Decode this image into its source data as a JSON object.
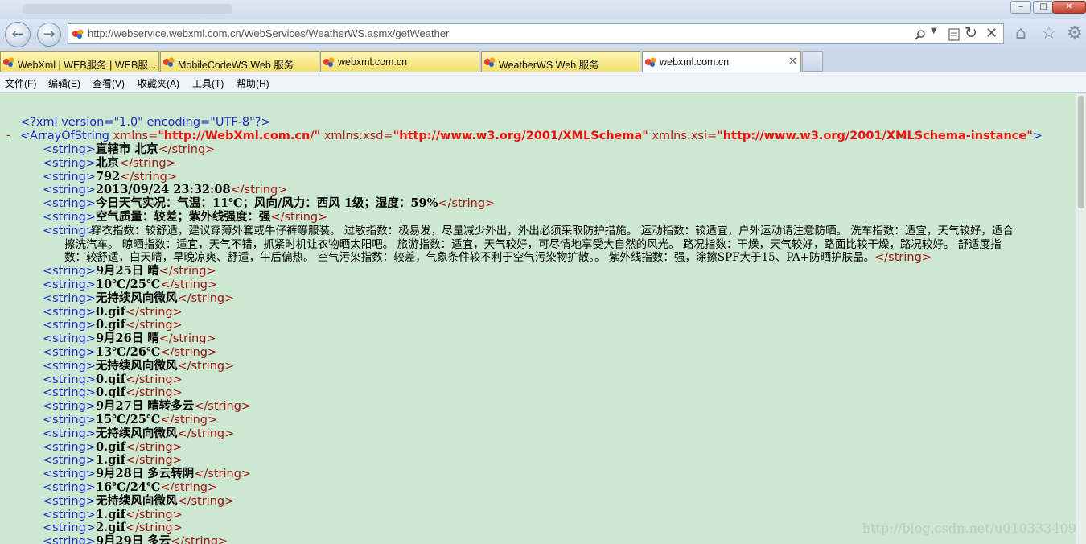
{
  "window": {
    "min": "‒",
    "max": "□",
    "close": "✕"
  },
  "nav": {
    "back": "←",
    "forward": "→",
    "address": "http://webservice.webxml.com.cn/WebServices/WeatherWS.asmx/getWeather",
    "search_icon": "search-icon",
    "refresh": "↻",
    "stop": "✕"
  },
  "tabs": [
    {
      "label": "WebXml | WEB服务 | WEB服..."
    },
    {
      "label": "MobileCodeWS Web 服务"
    },
    {
      "label": "webxml.com.cn"
    },
    {
      "label": "WeatherWS Web 服务"
    },
    {
      "label": "webxml.com.cn",
      "active": true
    }
  ],
  "menu": [
    "文件(F)",
    "编辑(E)",
    "查看(V)",
    "收藏夹(A)",
    "工具(T)",
    "帮助(H)"
  ],
  "xml": {
    "decl": "<?xml version=\"1.0\" encoding=\"UTF-8\"?>",
    "collapse": "-",
    "root_open": "<ArrayOfString",
    "attr1": " xmlns=",
    "val1": "\"http://WebXml.com.cn/\"",
    "attr2": " xmlns:xsd=",
    "val2": "\"http://www.w3.org/2001/XMLSchema\"",
    "attr3": " xmlns:xsi=",
    "val3": "\"http://www.w3.org/2001/XMLSchema-instance\"",
    "root_close": ">",
    "open": "<string>",
    "close": "</string>",
    "strings": [
      "直辖市 北京",
      "北京",
      "792",
      "2013/09/24 23:32:08",
      "今日天气实况：气温：11℃；风向/风力：西风 1级；湿度：59%",
      "空气质量：较差；紫外线强度：强",
      "9月25日 晴",
      "10℃/25℃",
      "无持续风向微风",
      "0.gif",
      "0.gif",
      "9月26日 晴",
      "13℃/26℃",
      "无持续风向微风",
      "0.gif",
      "0.gif",
      "9月27日 晴转多云",
      "15℃/25℃",
      "无持续风向微风",
      "0.gif",
      "1.gif",
      "9月28日 多云转阴",
      "16℃/24℃",
      "无持续风向微风",
      "1.gif",
      "2.gif",
      "9月29日 多云"
    ],
    "index_lines": [
      "穿衣指数：较舒适，建议穿薄外套或牛仔裤等服装。 过敏指数：极易发，尽量减少外出，外出必须采取防护措施。 运动指数：较适宜，户外运动请注意防晒。 洗车指数：适宜，天气较好，适合",
      "擦洗汽车。 晾晒指数：适宜，天气不错，抓紧时机让衣物晒太阳吧。 旅游指数：适宜，天气较好，可尽情地享受大自然的风光。 路况指数：干燥，天气较好，路面比较干燥，路况较好。 舒适度指",
      "数：较舒适，白天晴，早晚凉爽、舒适，午后偏热。 空气污染指数：较差，气象条件较不利于空气污染物扩散。。 紫外线指数：强，涂擦SPF大于15、PA+防晒护肤品。"
    ]
  },
  "watermark": "http://blog.csdn.net/u010333409"
}
